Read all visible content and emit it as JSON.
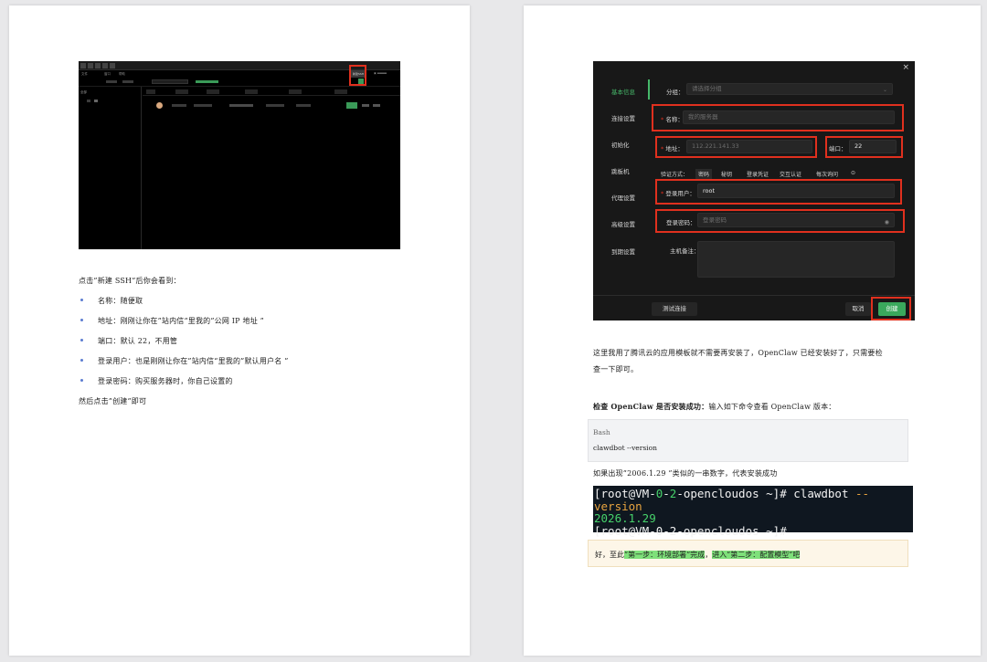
{
  "left_page": {
    "screenshot": {
      "menu": [
        "文件",
        "窗口",
        "帮助"
      ],
      "new_ssh_button": "新建SSH",
      "sidebar_label": "全部"
    },
    "intro": "点击”新建 SSH”后你会看到：",
    "bullets": [
      "名称：随便取",
      "地址：刚刚让你在”站内信“里我的”公网 IP 地址 ”",
      "端口：默认 22，不用管",
      "登录用户：也是刚刚让你在”站内信“里我的”默认用户名 ”",
      "登录密码：购买服务器时，你自己设置的"
    ],
    "outro": "然后点击”创建”即可"
  },
  "right_page": {
    "dialog": {
      "close": "×",
      "nav": [
        "基本信息",
        "连接设置",
        "初始化",
        "跳板机",
        "代理设置",
        "高级设置",
        "到期设置"
      ],
      "group_label": "分组：",
      "group_placeholder": "请选择分组",
      "name_label": "名称：",
      "name_placeholder": "我的服务器",
      "address_label": "地址：",
      "address_placeholder": "112.221.141.33",
      "port_label": "端口：",
      "port_value": "22",
      "auth_label": "验证方式：",
      "auth_tabs": [
        "密码",
        "秘钥",
        "登录凭证",
        "交互认证",
        "每次询问"
      ],
      "user_label": "登录用户：",
      "user_value": "root",
      "password_label": "登录密码：",
      "password_placeholder": "登录密码",
      "remark_label": "主机备注：",
      "test_button": "测试连接",
      "cancel_button": "取消",
      "create_button": "创建",
      "required_mark": "*"
    },
    "para1_line1": "这里我用了腾讯云的应用模板就不需要再安装了，OpenClaw 已经安装好了，只需要检",
    "para1_line2": "查一下即可。",
    "check_heading": "检查 OpenClaw 是否安装成功：",
    "check_text": "输入如下命令查看 OpenClaw 版本：",
    "code_lang": "Bash",
    "code_cmd": "clawdbot --version",
    "result_text": "如果出现”2006.1.29 ”类似的一串数字，代表安装成功",
    "terminal": {
      "prompt1_open": "[root@VM-",
      "prompt1_num1": "0",
      "prompt1_dash1": "-",
      "prompt1_num2": "2",
      "prompt1_rest": "-opencloudos ~]# ",
      "command": "clawdbot ",
      "flag": "--version",
      "output": "2026.1.29",
      "prompt2": "[root@VM-0-2-opencloudos ~]#"
    },
    "note_prefix": "好，至此",
    "note_hl1": "”第一步：环境部署”完成",
    "note_sep": "，",
    "note_hl2": "进入”第二步：配置模型”吧"
  }
}
